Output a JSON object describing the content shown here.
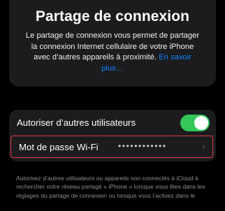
{
  "header": {
    "title": "Partage de connexion",
    "description": "Le partage de connexion vous permet de partager la connexion Internet cellulaire de votre iPhone avec d’autres appareils à proximité.",
    "learn_more_link": "En savoir plus…"
  },
  "settings": {
    "allow_others_label": "Autoriser d’autres utilisateurs",
    "allow_others_enabled": true,
    "wifi_password_label": "Mot de passe Wi-Fi",
    "wifi_password_masked": "••••••••••••",
    "chevron_icon": "chevron-right-icon"
  },
  "footer": {
    "note": "Autorisez d’autres utilisateurs ou appareils non connectés à iCloud à rechercher votre réseau partagé « iPhone » lorsque vous êtes dans les réglages du partage de connexion ou lorsque vous l’activez dans le"
  },
  "colors": {
    "toggle_on": "#34c759",
    "link": "#0a84ff",
    "highlight_border": "#e03b47"
  }
}
